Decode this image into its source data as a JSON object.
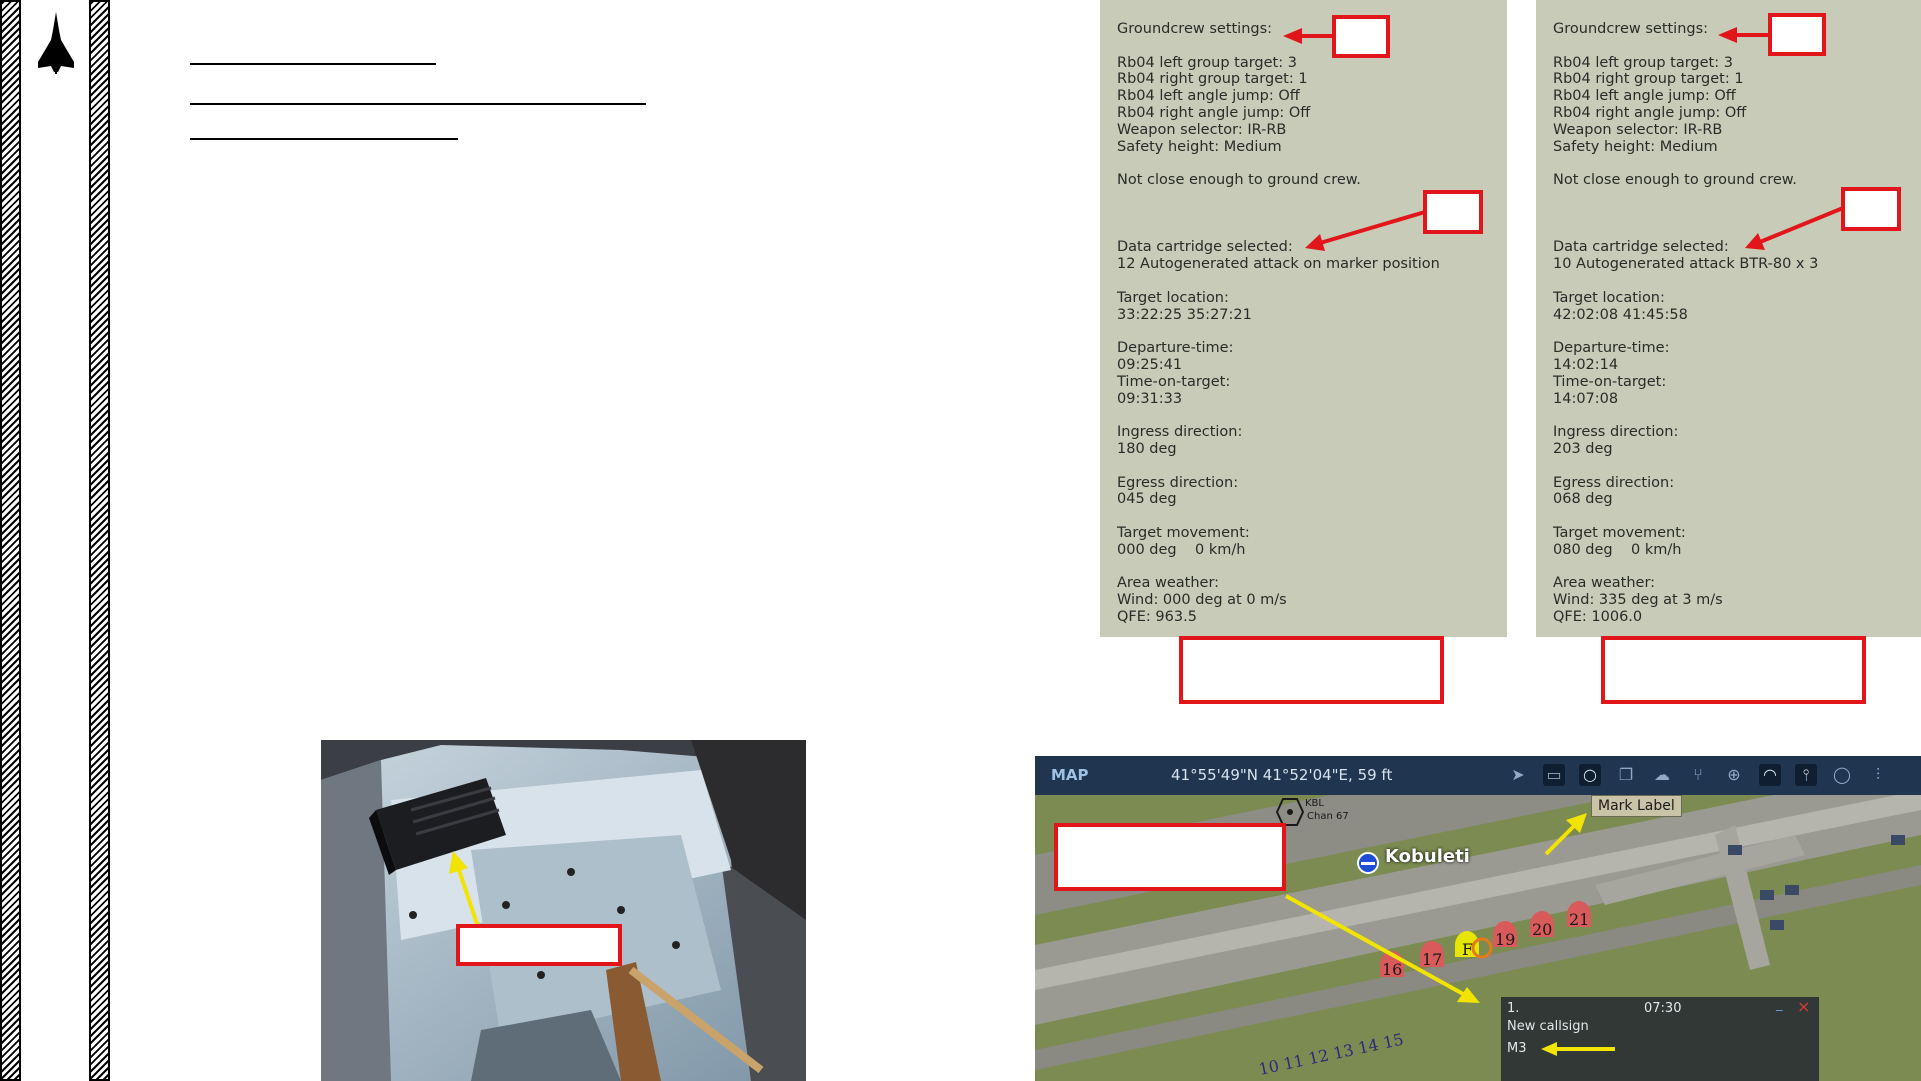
{
  "sidebar": {
    "logo_icon": "aircraft-silhouette-icon"
  },
  "panels": [
    {
      "groundcrew_settings": "Groundcrew settings:",
      "settings": [
        "Rb04 left group target: 3",
        "Rb04 right group target: 1",
        "Rb04 left angle jump: Off",
        "Rb04 right angle jump: Off",
        "Weapon selector: IR-RB",
        "Safety height: Medium"
      ],
      "status": "Not close enough to ground crew.",
      "cartridge_label": "Data cartridge selected:",
      "cartridge_value": "12 Autogenerated attack on marker position",
      "target_location_label": "Target location:",
      "target_location": "33:22:25 35:27:21",
      "departure_label": "Departure-time:",
      "departure": "09:25:41",
      "tot_label": "Time-on-target:",
      "tot": "09:31:33",
      "ingress_label": "Ingress direction:",
      "ingress": "180 deg",
      "egress_label": "Egress direction:",
      "egress": "045 deg",
      "movement_label": "Target movement:",
      "movement": "000 deg    0 km/h",
      "weather_label": "Area weather:",
      "wind": "Wind: 000 deg at 0 m/s",
      "qfe": "QFE: 963.5"
    },
    {
      "groundcrew_settings": "Groundcrew settings:",
      "settings": [
        "Rb04 left group target: 3",
        "Rb04 right group target: 1",
        "Rb04 left angle jump: Off",
        "Rb04 right angle jump: Off",
        "Weapon selector: IR-RB",
        "Safety height: Medium"
      ],
      "status": "Not close enough to ground crew.",
      "cartridge_label": "Data cartridge selected:",
      "cartridge_value": "10 Autogenerated attack BTR-80 x 3",
      "target_location_label": "Target location:",
      "target_location": "42:02:08 41:45:58",
      "departure_label": "Departure-time:",
      "departure": "14:02:14",
      "tot_label": "Time-on-target:",
      "tot": "14:07:08",
      "ingress_label": "Ingress direction:",
      "ingress": "203 deg",
      "egress_label": "Egress direction:",
      "egress": "068 deg",
      "movement_label": "Target movement:",
      "movement": "080 deg    0 km/h",
      "weather_label": "Area weather:",
      "wind": "Wind: 335 deg at 3 m/s",
      "qfe": "QFE: 1006.0"
    }
  ],
  "map": {
    "title": "MAP",
    "coords": "41°55'49\"N 41°52'04\"E, 59 ft",
    "tooltip": "Mark Label",
    "airfield": "Kobuleti",
    "beacon_name": "KBL",
    "beacon_channel": "Chan 67",
    "hardened_shelters": [
      "16",
      "17",
      "F",
      "19",
      "20",
      "21"
    ],
    "parking_numbers": "10 11 12 13 14 15",
    "toolbar_icons": [
      "send-icon",
      "battery-icon",
      "circle-mark-icon",
      "layers-icon",
      "cloud-icon",
      "graph-icon",
      "crosshair-icon",
      "wifi-icon",
      "tower-icon",
      "chat-icon",
      "equalizer-icon"
    ],
    "marker_popup": {
      "index": "1.",
      "time": "07:30",
      "callsign": "New callsign",
      "label": "M3",
      "minimize": "_",
      "close": "×"
    }
  },
  "colors": {
    "callout_red": "#e2161a",
    "arrow_yellow": "#f2e400",
    "panel_bg": "#c7cbb8",
    "map_bar": "#1f3550"
  }
}
